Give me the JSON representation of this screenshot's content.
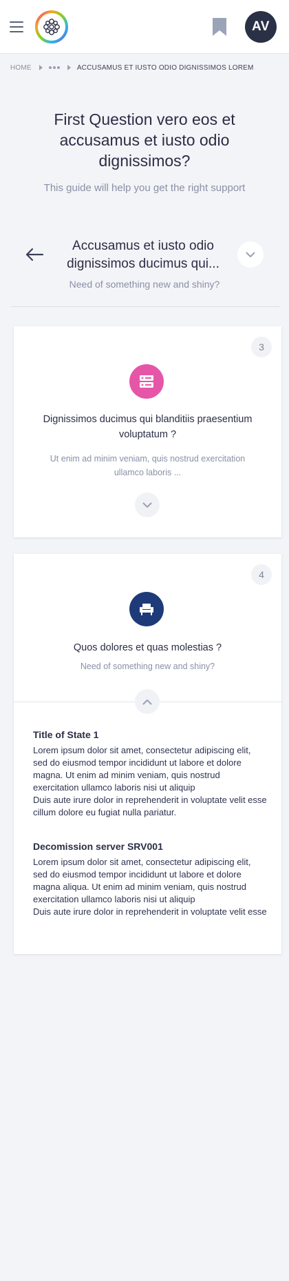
{
  "header": {
    "menu_icon": "hamburger-icon",
    "logo_icon": "rainbow-ring-logo",
    "bookmark_icon": "bookmark-icon",
    "avatar_initials": "AV",
    "colors": {
      "avatar_bg": "#2a3045",
      "bookmark": "#9aa3b8"
    }
  },
  "breadcrumb": {
    "home": "HOME",
    "ellipsis_icon": "more-dots-icon",
    "current": "ACCUSAMUS ET IUSTO ODIO DIGNISSIMOS LOREM"
  },
  "page": {
    "title": "First Question vero eos et accusamus et iusto odio dignissimos?",
    "subtitle": "This guide will help you get the right support"
  },
  "question": {
    "back_icon": "arrow-left-icon",
    "title_line1": "Accusamus et iusto odio",
    "title_line2": "dignissimos ducimus qui...",
    "subtitle": "Need of something new and shiny?",
    "toggle_icon": "chevron-down-icon"
  },
  "cards": [
    {
      "number": "3",
      "icon": "server-icon",
      "icon_color": "#e556a8",
      "title": "Dignissimos ducimus qui blanditiis praesentium voluptatum ?",
      "text": "Ut enim ad minim veniam, quis nostrud exercitation ullamco laboris ...",
      "toggle_icon": "chevron-down-icon"
    },
    {
      "number": "4",
      "icon": "armchair-icon",
      "icon_color": "#1f3a78",
      "title": "Quos dolores et quas molestias ?",
      "text": "Need of something new and shiny?",
      "toggle_icon": "chevron-up-icon",
      "states": [
        {
          "title": "Title of State 1",
          "body": "Lorem ipsum dolor sit amet, consectetur adipiscing elit, sed do eiusmod tempor incididunt ut labore et dolore magna. Ut enim ad minim veniam, quis nostrud exercitation ullamco laboris nisi ut aliquip\nDuis aute irure dolor in reprehenderit in voluptate velit esse cillum dolore eu fugiat nulla pariatur."
        },
        {
          "title": "Decomission server SRV001",
          "body": "Lorem ipsum dolor sit amet, consectetur adipiscing elit, sed do eiusmod tempor incididunt ut labore et dolore magna aliqua. Ut enim ad minim veniam, quis nostrud exercitation ullamco laboris nisi ut aliquip\nDuis aute irure dolor in reprehenderit in voluptate velit esse"
        }
      ]
    }
  ]
}
